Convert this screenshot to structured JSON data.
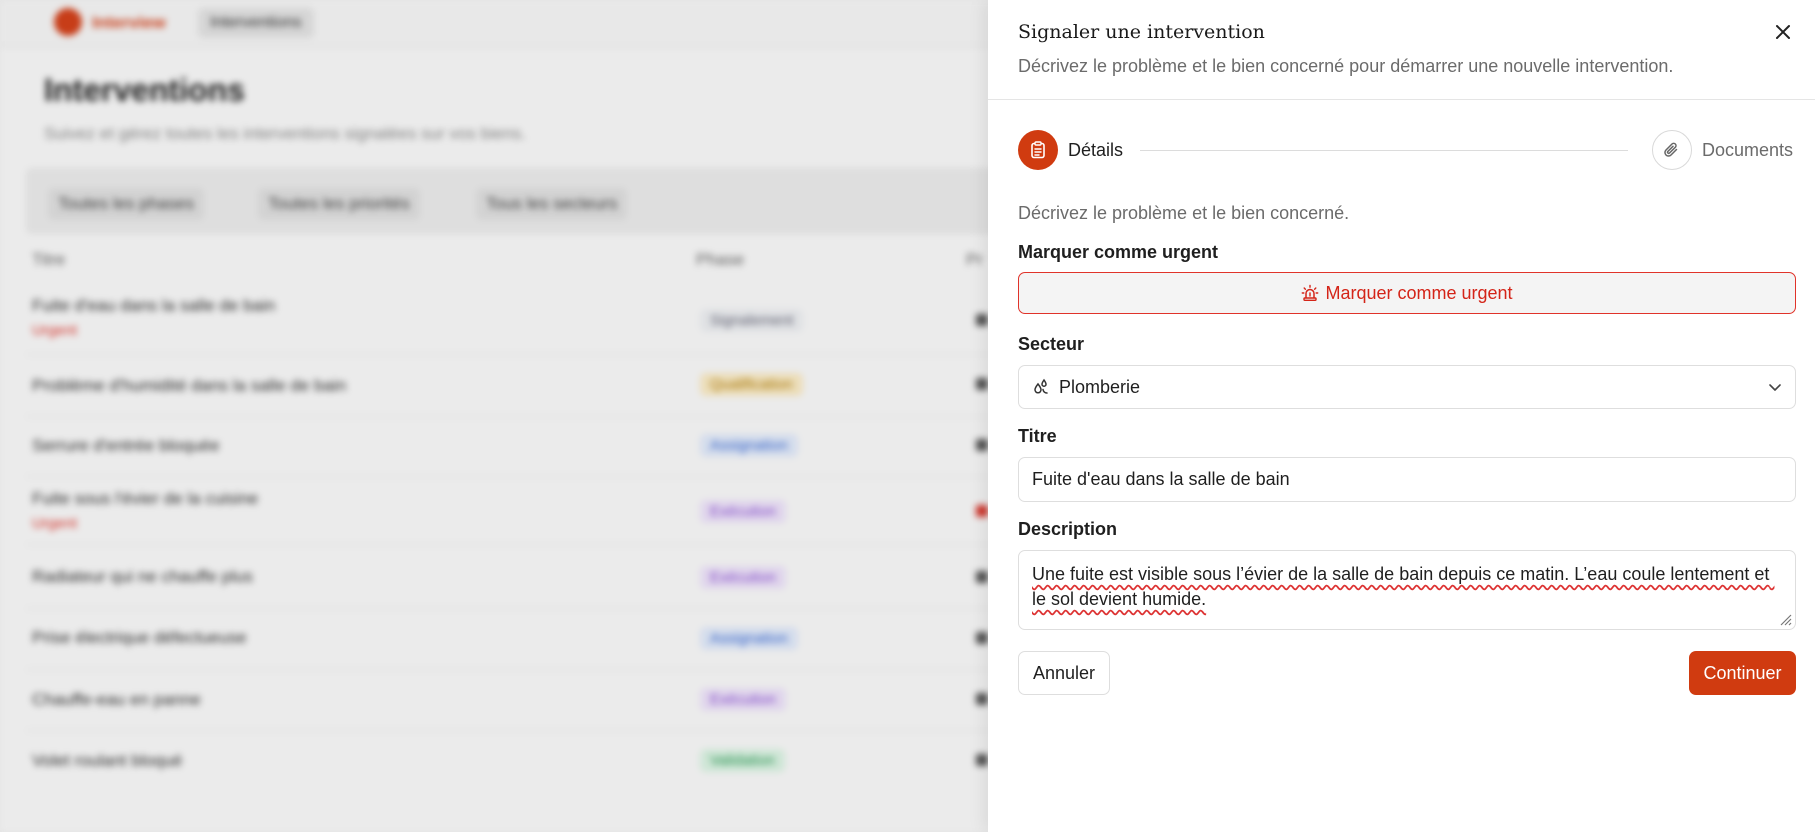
{
  "background": {
    "brand": "Interview",
    "nav_item": "Interventions",
    "page_title": "Interventions",
    "page_subtitle": "Suivez et gérez toutes les interventions signalées sur vos biens.",
    "filters": [
      "Toutes les phases",
      "Toutes les priorités",
      "Tous les secteurs"
    ],
    "columns": [
      "Titre",
      "Phase",
      "Pr"
    ],
    "rows": [
      {
        "title": "Fuite d'eau dans la salle de bain",
        "urgent": "Urgent",
        "phase": "Signalement"
      },
      {
        "title": "Problème d'humidité dans la salle de bain",
        "urgent": "",
        "phase": "Qualification"
      },
      {
        "title": "Serrure d'entrée bloquée",
        "urgent": "",
        "phase": "Assignation"
      },
      {
        "title": "Fuite sous l'évier de la cuisine",
        "urgent": "Urgent",
        "phase": "Exécution"
      },
      {
        "title": "Radiateur qui ne chauffe plus",
        "urgent": "",
        "phase": "Exécution"
      },
      {
        "title": "Prise électrique défectueuse",
        "urgent": "",
        "phase": "Assignation"
      },
      {
        "title": "Chauffe-eau en panne",
        "urgent": "",
        "phase": "Exécution"
      },
      {
        "title": "Volet roulant bloqué",
        "urgent": "",
        "phase": "Validation"
      }
    ]
  },
  "sheet": {
    "title": "Signaler une intervention",
    "subtitle": "Décrivez le problème et le bien concerné pour démarrer une nouvelle intervention.",
    "steps": [
      {
        "label": "Détails",
        "icon": "clipboard-icon",
        "active": true
      },
      {
        "label": "Documents",
        "icon": "paperclip-icon",
        "active": false
      }
    ],
    "intro": "Décrivez le problème et le bien concerné.",
    "urgent_label": "Marquer comme urgent",
    "urgent_button": "Marquer comme urgent",
    "sector_label": "Secteur",
    "sector_value": "Plomberie",
    "title_label": "Titre",
    "title_value": "Fuite d'eau dans la salle de bain",
    "description_label": "Description",
    "description_value": "Une fuite est visible sous l’évier de la salle de bain depuis ce matin. L’eau coule lentement et le sol devient humide.",
    "cancel": "Annuler",
    "continue": "Continuer"
  },
  "colors": {
    "accent": "#d03b10",
    "urgent": "#e0332a"
  }
}
